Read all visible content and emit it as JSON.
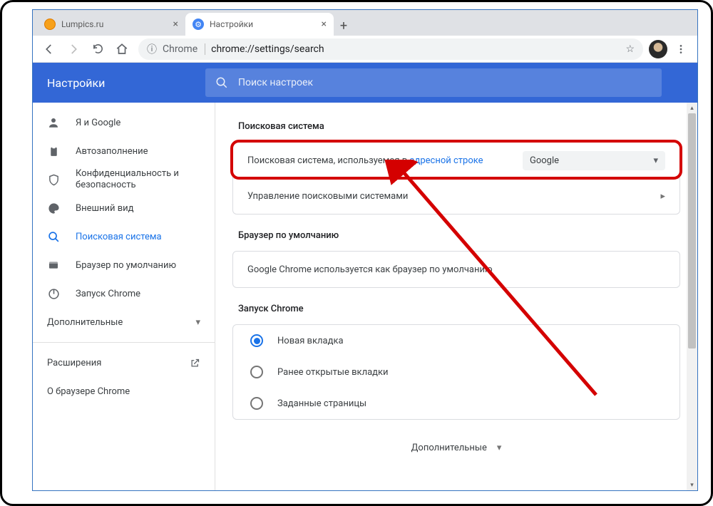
{
  "tabs": [
    {
      "title": "Lumpics.ru",
      "active": false,
      "icon_color": "#f7a11b"
    },
    {
      "title": "Настройки",
      "active": true,
      "icon_color": "#4285f4"
    }
  ],
  "omnibox": {
    "prefix": "Chrome",
    "url": "chrome://settings/search",
    "info_icon": "ⓘ"
  },
  "header": {
    "title": "Настройки",
    "search_placeholder": "Поиск настроек"
  },
  "sidebar": {
    "items": [
      {
        "label": "Я и Google",
        "icon": "person"
      },
      {
        "label": "Автозаполнение",
        "icon": "clipboard"
      },
      {
        "label": "Конфиденциальность и безопасность",
        "icon": "shield"
      },
      {
        "label": "Внешний вид",
        "icon": "palette"
      },
      {
        "label": "Поисковая система",
        "icon": "search",
        "active": true
      },
      {
        "label": "Браузер по умолчанию",
        "icon": "window"
      },
      {
        "label": "Запуск Chrome",
        "icon": "power"
      }
    ],
    "advanced": "Дополнительные",
    "extensions": "Расширения",
    "about": "О браузере Chrome"
  },
  "sections": {
    "search": {
      "title": "Поисковая система",
      "row1_prefix": "Поисковая система, используемая в ",
      "row1_link": "адресной строке",
      "selected_engine": "Google",
      "row2": "Управление поисковыми системами"
    },
    "default_browser": {
      "title": "Браузер по умолчанию",
      "text": "Google Chrome используется как браузер по умолчанию"
    },
    "startup": {
      "title": "Запуск Chrome",
      "options": [
        {
          "label": "Новая вкладка",
          "checked": true
        },
        {
          "label": "Ранее открытые вкладки",
          "checked": false
        },
        {
          "label": "Заданные страницы",
          "checked": false
        }
      ]
    },
    "more": "Дополнительные"
  }
}
